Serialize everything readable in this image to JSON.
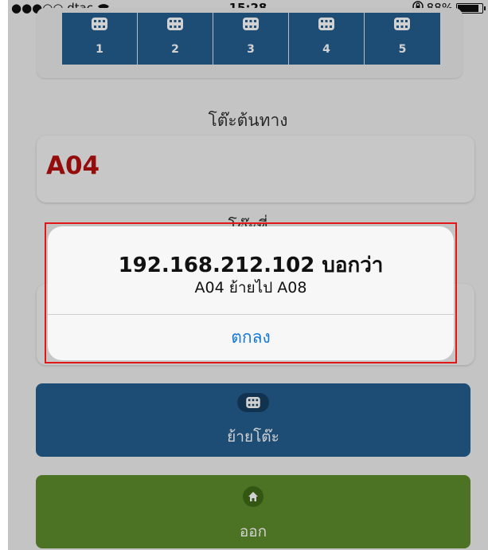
{
  "status_bar": {
    "carrier": "●●●○○ dtac",
    "time": "15:28",
    "battery": "88%",
    "battery_level": 0.88
  },
  "table_buttons": [
    {
      "label": "1",
      "icon": "grid-icon"
    },
    {
      "label": "2",
      "icon": "grid-icon"
    },
    {
      "label": "3",
      "icon": "grid-icon"
    },
    {
      "label": "4",
      "icon": "grid-icon"
    },
    {
      "label": "5",
      "icon": "grid-icon"
    }
  ],
  "source": {
    "title": "โต๊ะต้นทาง",
    "value": "A04"
  },
  "destination": {
    "title": "โต๊ะที่"
  },
  "actions": {
    "move_label": "ย้ายโต๊ะ",
    "exit_label": "ออก"
  },
  "alert": {
    "title": "192.168.212.102 บอกว่า",
    "message": "A04 ย้ายไป A08",
    "ok_label": "ตกลง"
  },
  "colors": {
    "primary_blue": "#245e8f",
    "exit_green": "#5d8c2c",
    "source_red": "#b60f10",
    "alert_link": "#1779d6",
    "highlight_red": "#e01818"
  }
}
